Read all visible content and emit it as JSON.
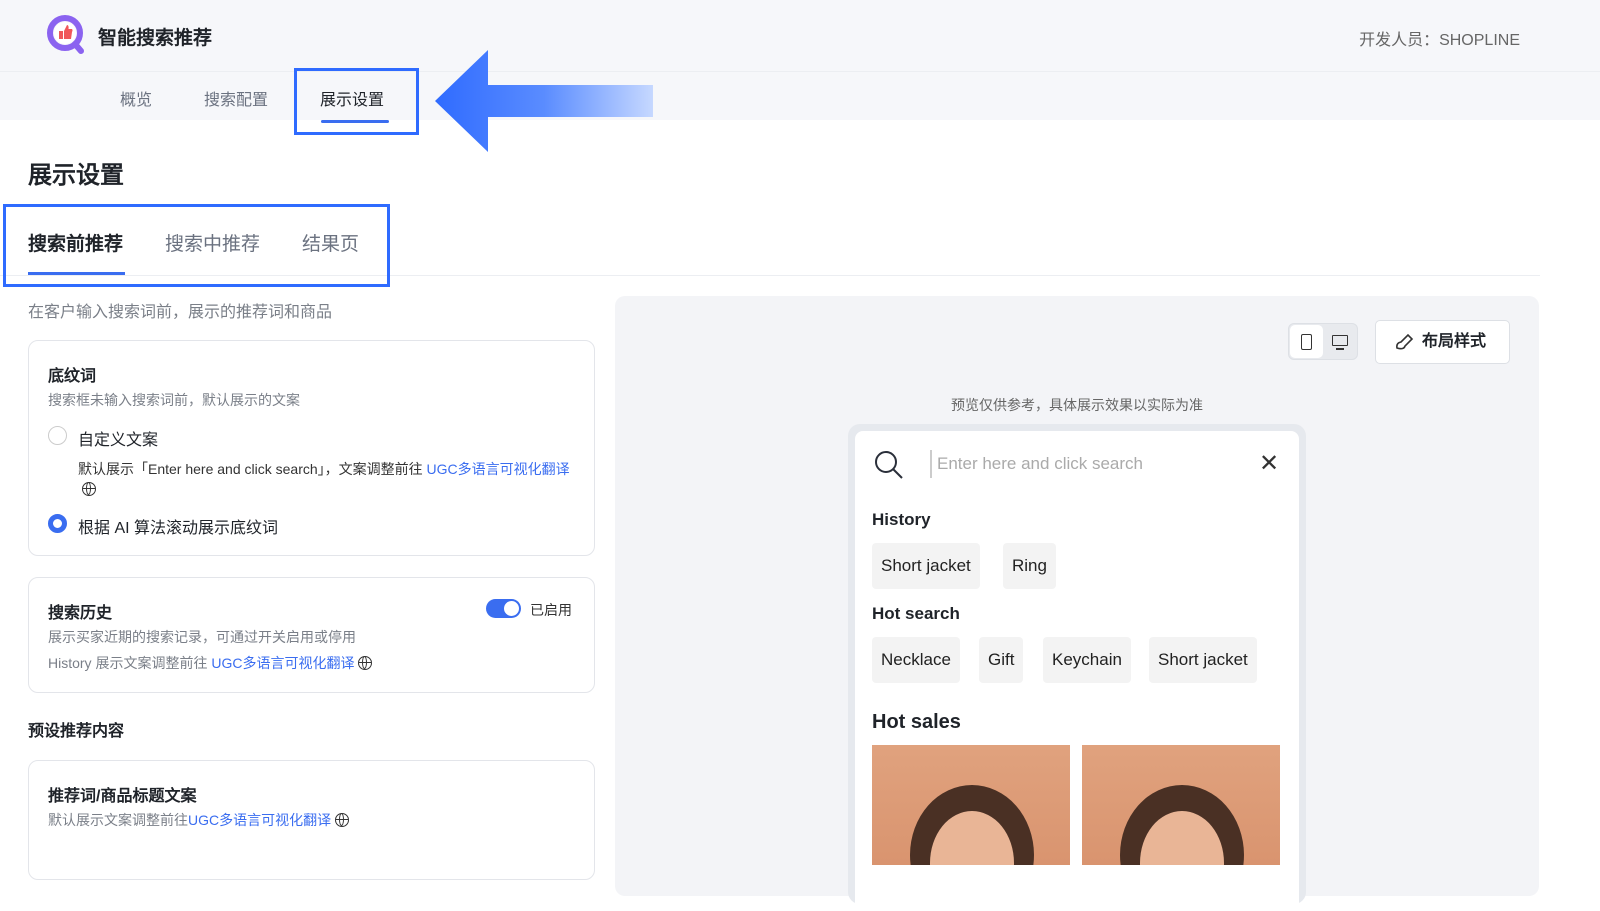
{
  "app": {
    "title": "智能搜索推荐",
    "developer": "开发人员：SHOPLINE"
  },
  "nav": {
    "tabs": [
      "概览",
      "搜索配置",
      "展示设置"
    ],
    "active": 2
  },
  "page": {
    "title": "展示设置",
    "subtabs": [
      "搜索前推荐",
      "搜索中推荐",
      "结果页"
    ],
    "description": "在客户输入搜索词前，展示的推荐词和商品"
  },
  "placeholder_card": {
    "title": "底纹词",
    "desc": "搜索框未输入搜索词前，默认展示的文案",
    "option1": "自定义文案",
    "option1_note": "默认展示「Enter here and click search」，文案调整前往 ",
    "option1_link": "UGC多语言可视化翻译",
    "option2": "根据 AI 算法滚动展示底纹词",
    "selected": 2
  },
  "history_card": {
    "title": "搜索历史",
    "toggle_label": "已启用",
    "toggle_on": true,
    "desc": "展示买家近期的搜索记录，可通过开关启用或停用",
    "note": "History 展示文案调整前往 ",
    "link": "UGC多语言可视化翻译"
  },
  "preset": {
    "heading": "预设推荐内容",
    "card_title": "推荐词/商品标题文案",
    "card_note": "默认展示文案调整前往",
    "card_link": "UGC多语言可视化翻译"
  },
  "preview": {
    "layout_button": "布局样式",
    "note": "预览仅供参考，具体展示效果以实际为准",
    "search_placeholder": "Enter here and click search",
    "history_title": "History",
    "history": [
      "Short jacket",
      "Ring"
    ],
    "hot_search_title": "Hot search",
    "hot_search": [
      "Necklace",
      "Gift",
      "Keychain",
      "Short jacket"
    ],
    "hot_sales_title": "Hot sales"
  },
  "colors": {
    "accent": "#3a6df0",
    "annotation": "#2f6bff"
  }
}
